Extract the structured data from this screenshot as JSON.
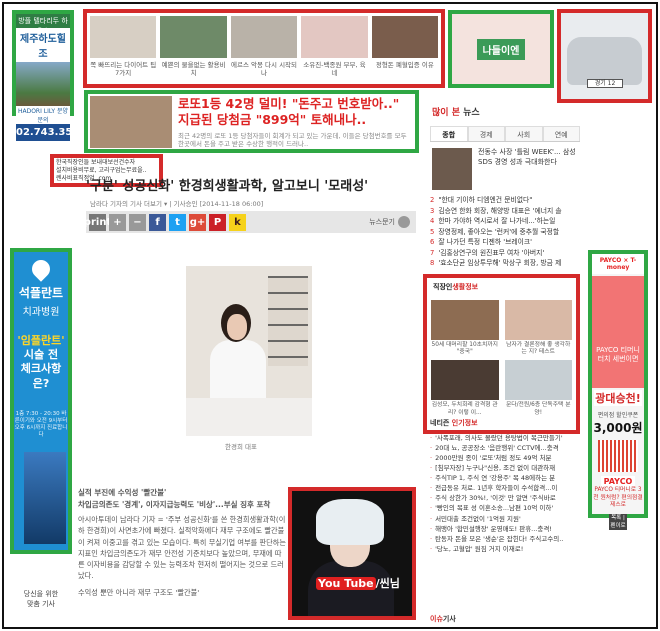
{
  "ads": {
    "jeju": {
      "top": "방플 텔타리두 하우스",
      "brand": "제주하도힐조",
      "sub": "HADORI LILY 분양문의",
      "phone": "02.743.3500"
    },
    "top_row": [
      {
        "caption": "쪽 빠뜨리는 다이어트 팁 7가지"
      },
      {
        "caption": "예쁜의 물을없는 활용비치"
      },
      {
        "caption": "에르스 악몽 다시 시작되나"
      },
      {
        "caption": "소유진-백종원 부부, 육네"
      },
      {
        "caption": "정형돈 폐혈입증 이유"
      }
    ],
    "nanum": "나들이엔",
    "car": {
      "plate": "경기 12"
    },
    "lotto": {
      "headline": "로또1등 42명 덜미! \"돈주고 번호받아..\" 지급된 당첨금 \"899억\" 토해내나..",
      "body": "최근 42명의 로또 1등 당첨자들이 회계가 되고 있는 가운데, 이들은 당첨번호를 모두 한곳에서 돈을 주고 받은 수상한 행적이 드러나.."
    },
    "info_box": [
      "한국직장인들 보내대보선건수자",
      "설치비용비무료, 고리구업는무료을..",
      "렌사비표직정엄 .com"
    ],
    "implant_left": {
      "n1": "석플란트",
      "n2": "치과병원",
      "yellow": "'임플란트'",
      "q1": "시술 전",
      "q2": "체크사항은?",
      "small": "1층 7:30 - 20:30 바른이기와 오전 9시부터 오후 6시까지 진료합니다"
    },
    "youtube": {
      "brand": "You Tube",
      "suffix": "/씬님"
    },
    "payco": {
      "top": "PAYCO × T-money",
      "line1": "PAYCO 티머니",
      "line2": "터치 세번이면",
      "big": "광대승천!",
      "coupon": "편의점 할인쿠폰",
      "won": "3,000원",
      "logo": "PAYCO",
      "note": "PAYCO 티머니로 3천 원처럼? 편의점결제스로",
      "btn": "목록 | 펜이로"
    }
  },
  "article": {
    "title": "'구분' 성공신화' 한경희생활과학, 알고보니 '모래성'",
    "byline": "남라다 기자의 기사 더보기 ▾ | 기사승인 [2014-11-18 06:00]",
    "newsstand": "뉴스문기",
    "photo_caption": "한경희 대표",
    "sub1": "실적 부진에 수익성 '빨간불'",
    "sub2": "차입금의존도 '경계', 이자지급능력도 '비상'...부실 징후 포착",
    "paragraphs": [
      "아시아투데이 남라다 기자 = '주부 성공신화'를 쓴 한경희생활과학(이하 한경희)이 사면초가에 빠졌다. 실적악화에다 재무 구조에도 빨간불이 켜져 이중고를 겪고 있는 모습이다. 특히 무실기업 여부를 판단하는 지표인 차입금의존도가 재무 안전성 기준치보다 높았으며, 무재에 따른 이자비용을 감당할 수 있는 능력조차 현저히 떨어지는 것으로 드러났다.",
      "수익성 뿐만 아니라 재무 구조도 '빨간불'"
    ]
  },
  "share": {
    "print": "print",
    "plus": "+",
    "minus": "−",
    "fb": "f",
    "tw": "t",
    "gp": "g+",
    "pin": "P",
    "kakao": "k"
  },
  "popular": {
    "head_b": "많이 본",
    "head": "뉴스",
    "tabs": [
      "종합",
      "경제",
      "사회",
      "연예"
    ],
    "top_item": "전동수 사장 '틀림 WEEK'... 삼성SDS 경영 성과 극대화한다",
    "items": [
      "\"한대 기이하 디엠엔건 문비없다\"",
      "김승연 한화 회장, 해양방 대표은 '에너지 솔",
      "한마 가야하 역시로서 잘 나가네...'하는일",
      "장영정제, 좋아오는 '런커'에 중추월 국정할",
      "잘 나가던 특정 디젠하 '브레이크'",
      "'김홍상연구의 원진표무 여차 '아버지'",
      "'효소단균 임상투무해' 막상구 회장, 방금 제"
    ]
  },
  "custom": {
    "head_pre": "직장인",
    "head_b": "생활정보",
    "cells": [
      {
        "caption": "50세 대머리할 10초치까지 \"중국\""
      },
      {
        "caption": "남자가 결론정해 좋 생각하는 지? 테스트"
      },
      {
        "caption": "김성모, 두치회례 감격형 관리? 이렇 이..."
      },
      {
        "caption": "문다/전원/6층 단독주택 분양!"
      }
    ]
  },
  "industry": {
    "head_pre": "네티즌",
    "head_b": "인기정보",
    "items": [
      "'사폭포래, 의사도 몰랐던 용탕법이 복근만들기'",
      "20대 뇨, 공공장소 '음란행위' CCTV에...충격",
      "2000만원 종이 '로또'처럼 정도 49억 처분",
      "[침부자장] 누구나\"신용, 조건 없이 대관하재",
      "주식TIP 1, 주식 연 '강용주' 목 48에하는 분",
      "전급동유 처로. 1년후 학자들이 수석합격...이",
      "주식 상한가 30%!, '이것' 만 알면 '주식바로",
      "'빵인의 목표 성 이혼소송...남편 10억 이하'",
      "서민대출 조건없이 '1억원 지원'",
      "해맹아 '합민설행장' 운영매도! 판휴...충격!",
      "탄동자 돈을 모은 '생순'은 잡힌다! 주식고수의..",
      "'당노, 고혈압' 원짐 거지 이재로!"
    ]
  },
  "issue": {
    "head_b": "이슈",
    "head": "기사"
  },
  "left_bottom": [
    "당신을 위한",
    "맞춤 기사"
  ]
}
